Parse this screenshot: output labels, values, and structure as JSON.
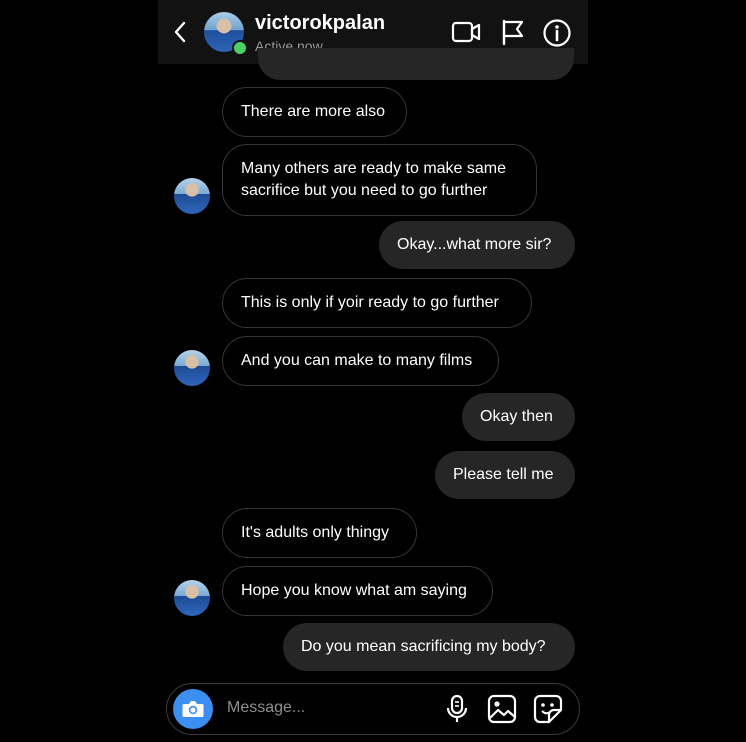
{
  "header": {
    "username": "victorokpalan",
    "status": "Active now",
    "icons": [
      "back-chevron-icon",
      "video-call-icon",
      "flag-icon",
      "info-icon"
    ]
  },
  "messages": [
    {
      "side": "incoming",
      "text": "There are more also"
    },
    {
      "side": "incoming",
      "text": "Many others are ready to make same sacrifice but you need to go further",
      "lines": [
        "Many others are ready to make same",
        "sacrifice but you need to go further"
      ]
    },
    {
      "side": "outgoing",
      "text": "Okay...what more sir?"
    },
    {
      "side": "incoming",
      "text": "This is only if yoir ready to go further"
    },
    {
      "side": "incoming",
      "text": "And you can make to many films"
    },
    {
      "side": "outgoing",
      "text": "Okay then"
    },
    {
      "side": "outgoing",
      "text": "Please tell me"
    },
    {
      "side": "incoming",
      "text": "It's adults only thingy"
    },
    {
      "side": "incoming",
      "text": "Hope you know what am saying"
    },
    {
      "side": "outgoing",
      "text": "Do you mean sacrificing my body?"
    }
  ],
  "composer": {
    "placeholder": "Message...",
    "icons": [
      "camera-icon",
      "microphone-icon",
      "gallery-icon",
      "sticker-icon"
    ]
  },
  "colors": {
    "background": "#000000",
    "header": "#121212",
    "outgoing_bubble": "#262626",
    "incoming_border": "#363636",
    "online": "#4ad066",
    "camera_button": "#3a8ff0"
  }
}
